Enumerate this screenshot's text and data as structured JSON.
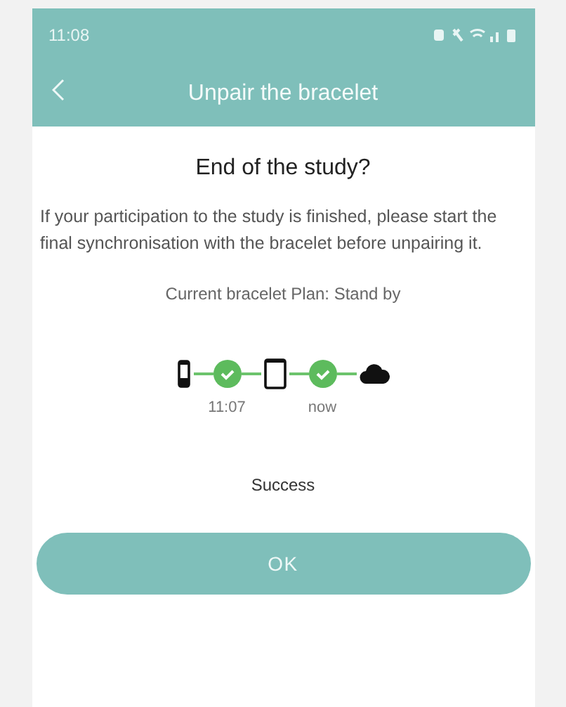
{
  "status_bar": {
    "time": "11:08"
  },
  "header": {
    "title": "Unpair the bracelet"
  },
  "heading": "End of the study?",
  "message": "If your participation to the study is finished, please start the final synchronisation with the bracelet before unpairing it.",
  "plan": "Current bracelet Plan: Stand by",
  "sync": [
    {
      "kind": "bracelet"
    },
    {
      "kind": "link",
      "done": true,
      "label": "11:07"
    },
    {
      "kind": "phone"
    },
    {
      "kind": "link",
      "done": true,
      "label": "now"
    },
    {
      "kind": "cloud"
    }
  ],
  "result": "Success",
  "button": "OK"
}
